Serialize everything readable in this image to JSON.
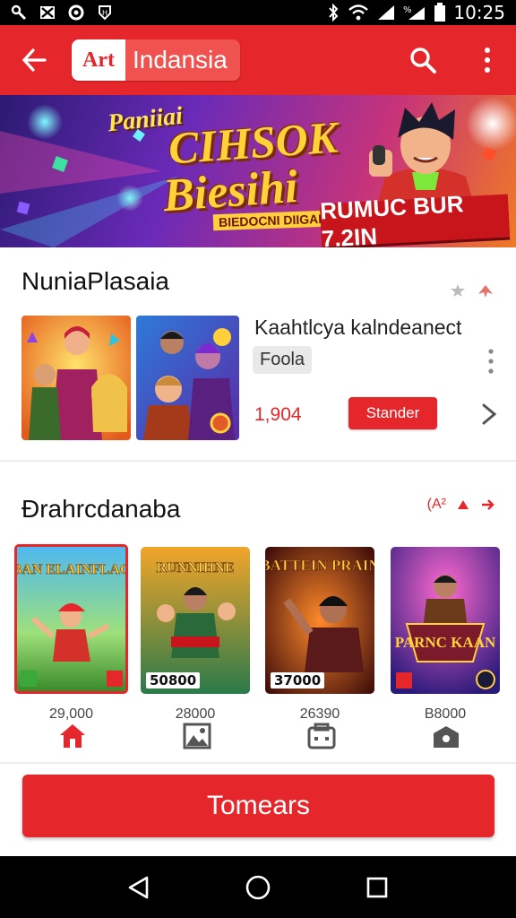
{
  "status_bar": {
    "time": "10:25",
    "icons": [
      "tools-icon",
      "mail-icon",
      "sync-icon",
      "shield-icon",
      "wifi-icon",
      "signal-icon",
      "battery-icon"
    ]
  },
  "app_bar": {
    "logo_badge": "Art",
    "title": "Indansia",
    "icons": [
      "back-arrow-icon",
      "search-icon",
      "more-vert-icon"
    ],
    "accent_color": "#e5262a"
  },
  "banner": {
    "kicker": "Paniiai",
    "title_line1": "CIHSOK",
    "title_line2": "Biesihi",
    "subtitle": "BIEDOCNI DIIGAI",
    "ribbon": "RUMUC BUR 7.2IN"
  },
  "section1": {
    "title": "NuniaPlasaia",
    "app_name": "Kaahtlcya kalndeanect",
    "chip": "Foola",
    "price": "1,904",
    "buy_label": "Stander"
  },
  "section2": {
    "title": "Ðrahrcdanaba",
    "action": "(A²",
    "games": [
      {
        "art_title": "PUBAN ELAINFLACCS",
        "price_tag": "",
        "label": "29,000",
        "tab_icon": "home-icon"
      },
      {
        "art_title": "RUNNIHNE",
        "price_tag": "50800",
        "label": "28000",
        "tab_icon": "image-icon"
      },
      {
        "art_title": "BATTEIN PRAIN",
        "price_tag": "37000",
        "label": "26390",
        "tab_icon": "bag-icon"
      },
      {
        "art_title": "PARNC KAAN",
        "price_tag": "",
        "label": "B8000",
        "tab_icon": "box-icon"
      }
    ]
  },
  "cta": {
    "label": "Tomears"
  },
  "nav": {
    "icons": [
      "back-triangle-icon",
      "home-circle-icon",
      "recents-square-icon"
    ]
  }
}
